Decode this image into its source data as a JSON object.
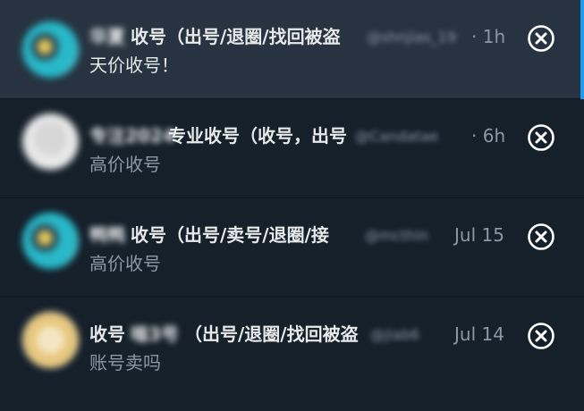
{
  "conversations": [
    {
      "blurred_name": "华夏",
      "name": "收号（出号/退圈/找回被盗",
      "handle": "@shnjias_19",
      "time": "· 1h",
      "message": "天价收号！",
      "selected": true
    },
    {
      "blurred_name": "专注2024",
      "name": "专业收号（收号，出号",
      "handle": "@Candatae",
      "time": "· 6h",
      "message": "高价收号",
      "selected": false
    },
    {
      "blurred_name": "鸭鸭",
      "name": "收号（出号/卖号/退圈/接",
      "handle": "@mcthin",
      "time": "Jul 15",
      "message": "高价收号",
      "selected": false
    },
    {
      "name_prefix": "收号",
      "blurred_name": "喵3号",
      "name": "（出号/退圈/找回被盗",
      "handle": "@jiab6",
      "time": "Jul 14",
      "message": "账号卖吗",
      "selected": false
    }
  ],
  "icons": {
    "close": "close-circle-icon"
  },
  "colors": {
    "background": "#15202b",
    "selected_background": "#273340",
    "accent": "#1d9bf0",
    "primary_text": "#e7e9ea",
    "secondary_text": "#8b98a5"
  }
}
